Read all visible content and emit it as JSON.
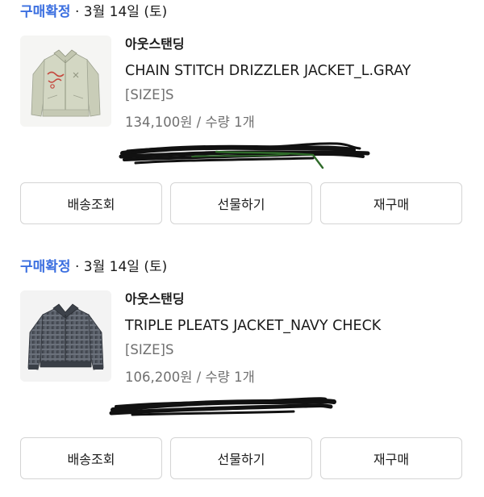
{
  "orders": [
    {
      "status": "구매확정",
      "separator": "·",
      "date": "3월 14일 (토)",
      "brand": "아웃스탠딩",
      "product_name": "CHAIN STITCH DRIZZLER JACKET_L.GRAY",
      "size": "[SIZE]S",
      "price_qty": "134,100원 / 수량 1개",
      "thumbnail_icon": "light-gray-jacket-image",
      "buttons": {
        "track": "배송조회",
        "gift": "선물하기",
        "rebuy": "재구매"
      }
    },
    {
      "status": "구매확정",
      "separator": "·",
      "date": "3월 14일 (토)",
      "brand": "아웃스탠딩",
      "product_name": "TRIPLE PLEATS JACKET_NAVY CHECK",
      "size": "[SIZE]S",
      "price_qty": "106,200원 / 수량 1개",
      "thumbnail_icon": "navy-check-jacket-image",
      "buttons": {
        "track": "배송조회",
        "gift": "선물하기",
        "rebuy": "재구매"
      }
    }
  ],
  "colors": {
    "status": "#3b6fe0",
    "secondary_text": "#6f6f6f",
    "button_border": "#d4d4d4",
    "scribble": "#111111",
    "scribble_accent": "#2f6b2a"
  }
}
